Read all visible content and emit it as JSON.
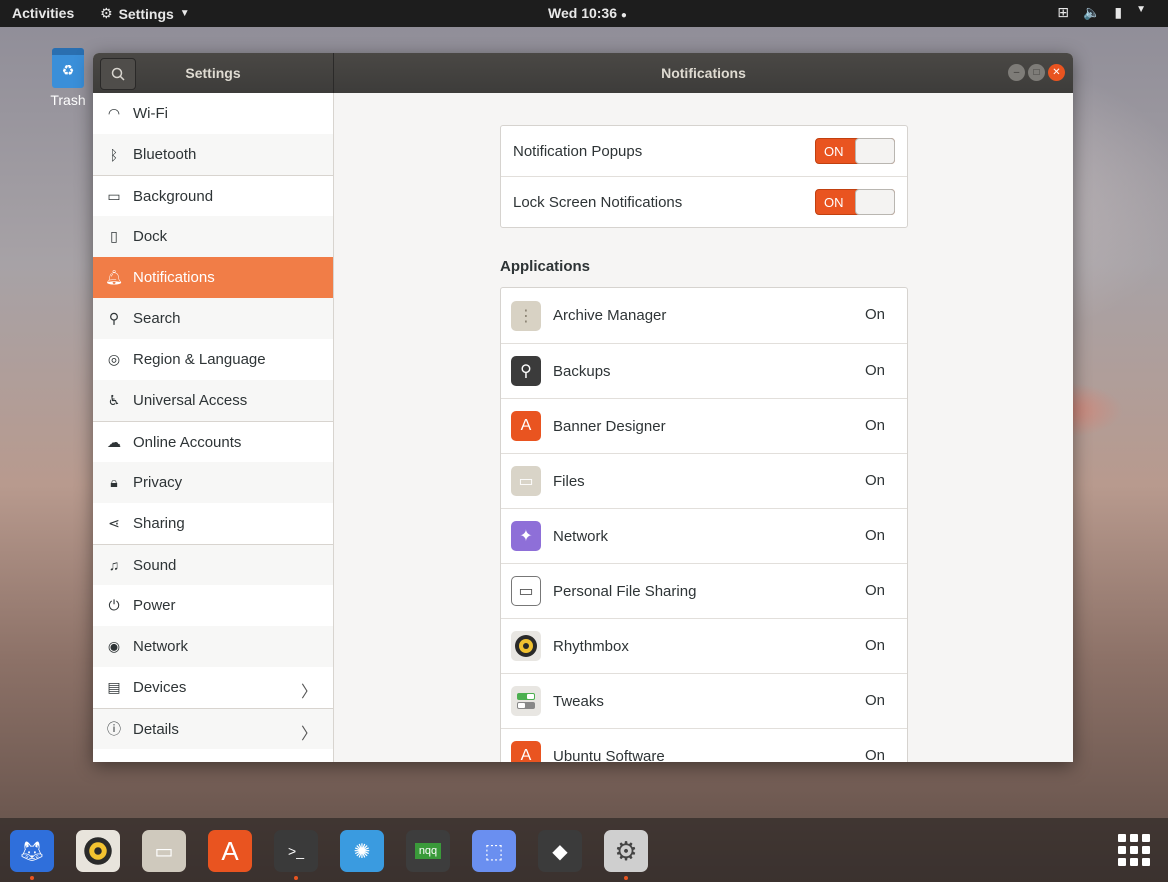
{
  "topbar": {
    "activities": "Activities",
    "app_menu": "Settings",
    "clock": "Wed 10:36"
  },
  "desktop": {
    "trash_label": "Trash"
  },
  "window": {
    "sidebar_title": "Settings",
    "page_title": "Notifications"
  },
  "sidebar": {
    "items": [
      {
        "label": "Wi-Fi",
        "icon": "wifi-icon"
      },
      {
        "label": "Bluetooth",
        "icon": "bluetooth-icon"
      },
      {
        "label": "Background",
        "icon": "background-icon"
      },
      {
        "label": "Dock",
        "icon": "dock-icon"
      },
      {
        "label": "Notifications",
        "icon": "bell-icon"
      },
      {
        "label": "Search",
        "icon": "search-icon"
      },
      {
        "label": "Region & Language",
        "icon": "globe-icon"
      },
      {
        "label": "Universal Access",
        "icon": "accessibility-icon"
      },
      {
        "label": "Online Accounts",
        "icon": "cloud-icon"
      },
      {
        "label": "Privacy",
        "icon": "lock-icon"
      },
      {
        "label": "Sharing",
        "icon": "share-icon"
      },
      {
        "label": "Sound",
        "icon": "music-note-icon"
      },
      {
        "label": "Power",
        "icon": "power-icon"
      },
      {
        "label": "Network",
        "icon": "network-globe-icon"
      },
      {
        "label": "Devices",
        "icon": "devices-icon"
      },
      {
        "label": "Details",
        "icon": "info-icon"
      }
    ],
    "active": "Notifications"
  },
  "toggles": [
    {
      "label": "Notification Popups",
      "state": "ON"
    },
    {
      "label": "Lock Screen Notifications",
      "state": "ON"
    }
  ],
  "applications": {
    "heading": "Applications",
    "items": [
      {
        "name": "Archive Manager",
        "state": "On",
        "color": "#d8d2c4"
      },
      {
        "name": "Backups",
        "state": "On",
        "color": "#3b3b3b"
      },
      {
        "name": "Banner Designer",
        "state": "On",
        "color": "#e95420"
      },
      {
        "name": "Files",
        "state": "On",
        "color": "#d9d4c8"
      },
      {
        "name": "Network",
        "state": "On",
        "color": "#8e6fd8"
      },
      {
        "name": "Personal File Sharing",
        "state": "On",
        "color": "#ffffff"
      },
      {
        "name": "Rhythmbox",
        "state": "On",
        "color": "#e8e6e2"
      },
      {
        "name": "Tweaks",
        "state": "On",
        "color": "#e8e6e2"
      },
      {
        "name": "Ubuntu Software",
        "state": "On",
        "color": "#e95420"
      }
    ]
  },
  "dock": {
    "apps": [
      {
        "name": "firefox-icon",
        "color": "#2f6fdb"
      },
      {
        "name": "rhythmbox-icon",
        "color": "#e8e4dc"
      },
      {
        "name": "files-icon",
        "color": "#cfc9bd"
      },
      {
        "name": "ubuntu-software-icon",
        "color": "#e95420"
      },
      {
        "name": "terminal-icon",
        "color": "#3a3a3a"
      },
      {
        "name": "shutter-icon",
        "color": "#3a9be0"
      },
      {
        "name": "nqq-icon",
        "color": "#3d3d3d"
      },
      {
        "name": "screenshot-icon",
        "color": "#6a8ff0"
      },
      {
        "name": "inkscape-icon",
        "color": "#3b3b3b"
      },
      {
        "name": "settings-icon",
        "color": "#cfcfcf"
      }
    ],
    "nqq_label": "nqq"
  },
  "colors": {
    "accent": "#e95420",
    "sidebar_active": "#f17d47"
  }
}
